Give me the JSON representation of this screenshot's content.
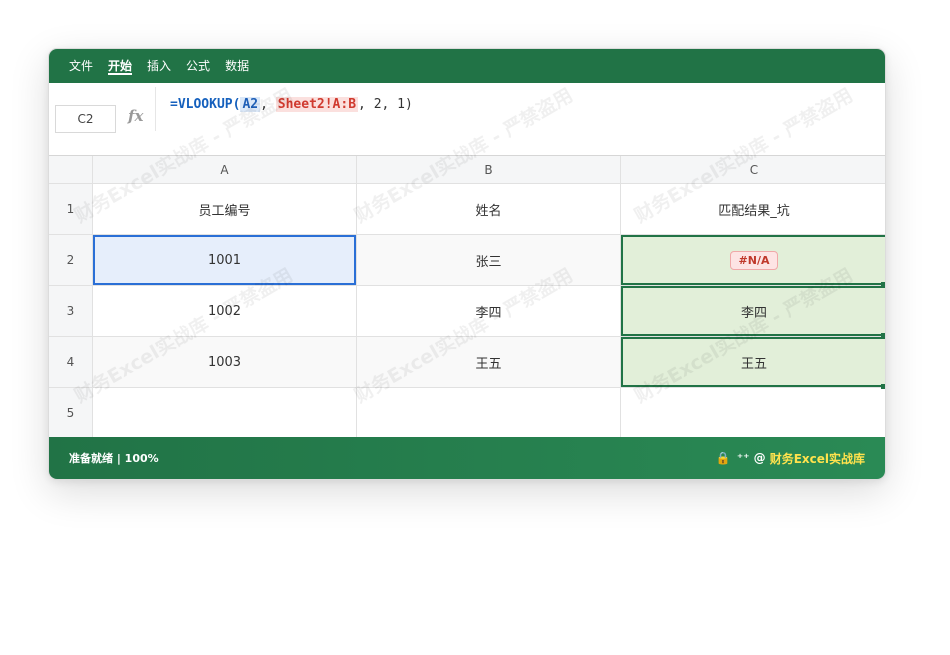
{
  "menu": {
    "items": [
      {
        "label": "文件"
      },
      {
        "label": "开始"
      },
      {
        "label": "插入"
      },
      {
        "label": "公式"
      },
      {
        "label": "数据"
      }
    ]
  },
  "formula_bar": {
    "name_box": "C2",
    "fx": "fx",
    "formula_parts": {
      "eq_func": "=VLOOKUP(",
      "ref1": "A2",
      "sep1": ", ",
      "ref2": "Sheet2!A:B",
      "rest": ", 2, 1)"
    }
  },
  "grid": {
    "columns": [
      "A",
      "B",
      "C"
    ],
    "rows": [
      "1",
      "2",
      "3",
      "4",
      "5"
    ],
    "cells": {
      "A1": "员工编号",
      "B1": "姓名",
      "C1": "匹配结果_坑",
      "A2": "1001",
      "B2": "张三",
      "C2": "#N/A",
      "A3": "1002",
      "B3": "李四",
      "C3": "李四",
      "A4": "1003",
      "B4": "王五",
      "C4": "王五"
    }
  },
  "status": {
    "left": "准备就绪 | 100%",
    "lock_icon": "🔒",
    "at": "⁺⁺ @",
    "brand": "财务Excel实战库"
  },
  "watermark": "财务Excel实战库 - 严禁盗用",
  "colors": {
    "excel_green": "#217346",
    "selection_blue": "#2a6fd6",
    "error_red": "#c0392b"
  }
}
